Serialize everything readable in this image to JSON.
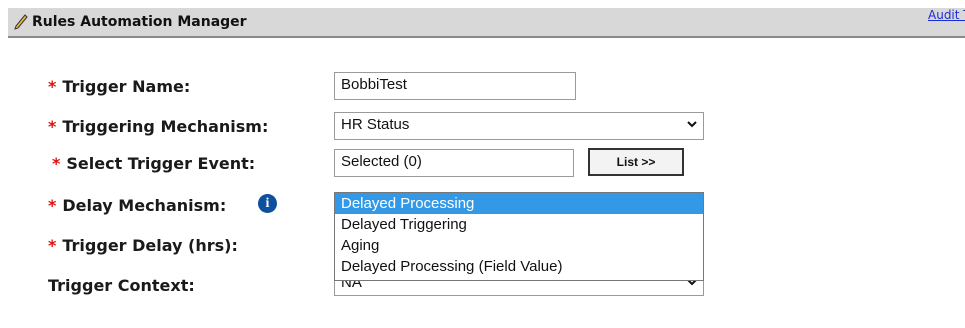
{
  "header": {
    "title": "Rules Automation Manager",
    "audit_link": "Audit T"
  },
  "form": {
    "trigger_name": {
      "label": "Trigger Name:",
      "value": "BobbiTest"
    },
    "triggering_mechanism": {
      "label": "Triggering Mechanism:",
      "value": "HR Status"
    },
    "select_trigger_event": {
      "label": "Select Trigger Event:",
      "value": "Selected (0)",
      "button_label": "List >>"
    },
    "delay_mechanism": {
      "label": "Delay Mechanism:",
      "options": [
        "Delayed Processing",
        "Delayed Triggering",
        "Aging",
        "Delayed Processing (Field Value)"
      ],
      "highlighted": "Delayed Processing"
    },
    "trigger_delay": {
      "label": "Trigger Delay (hrs):"
    },
    "trigger_context": {
      "label": "Trigger Context:",
      "value": "NA"
    }
  },
  "required_marker": "*",
  "icons": {
    "title": "pencil-icon",
    "info": "info-icon",
    "dropdown": "chevron-down-icon"
  },
  "colors": {
    "required": "#dd1111",
    "link": "#1a2cd6",
    "highlight": "#3399e6",
    "info": "#0f4fa0"
  }
}
